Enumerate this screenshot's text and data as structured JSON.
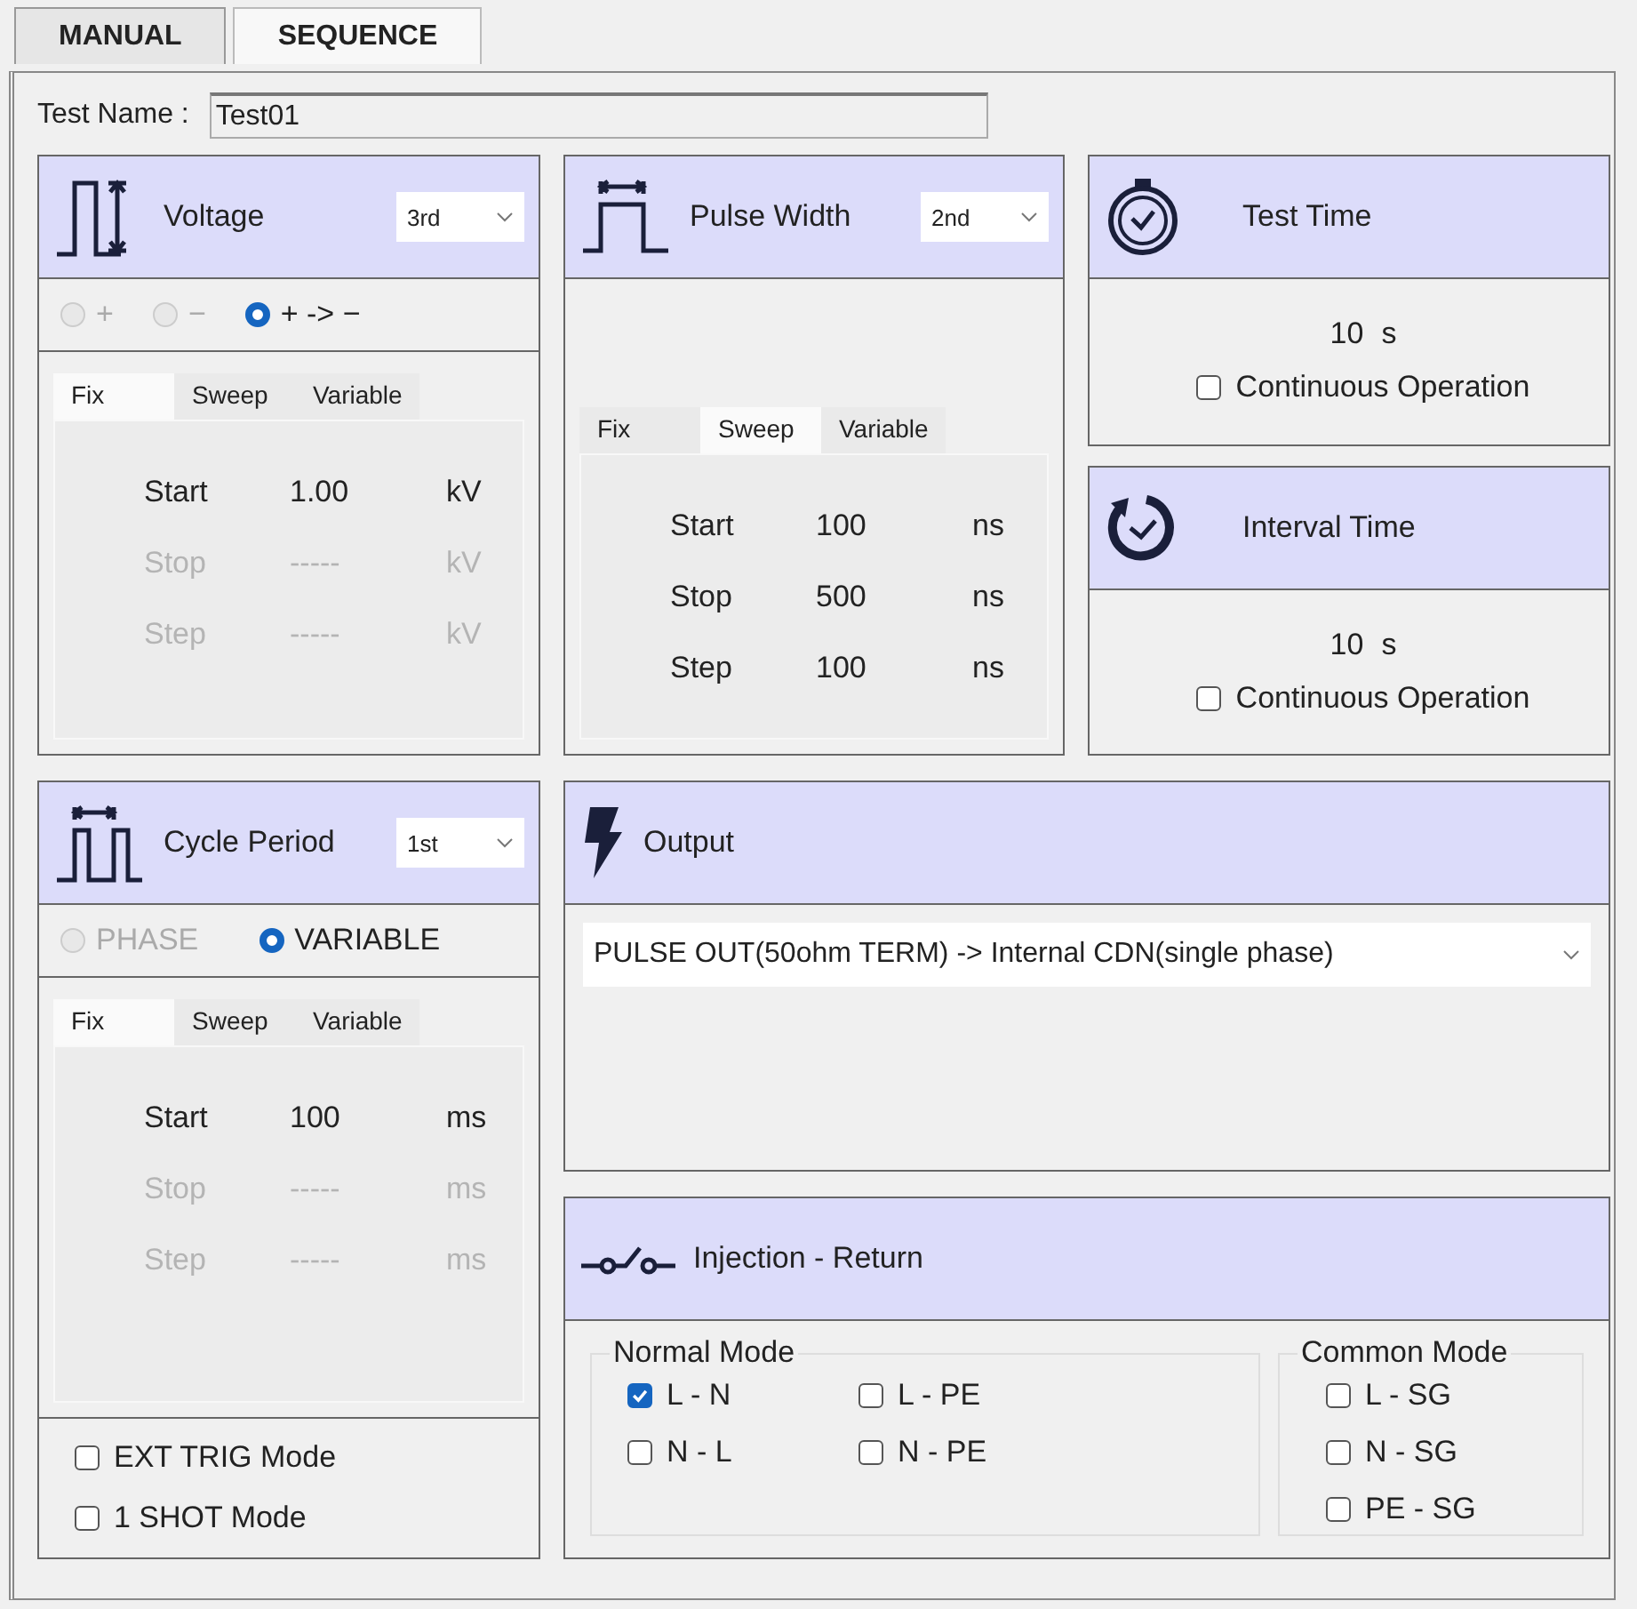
{
  "tabs": [
    {
      "label": "MANUAL",
      "selected": false
    },
    {
      "label": "SEQUENCE",
      "selected": true
    }
  ],
  "test_name": {
    "label": "Test Name :",
    "value": "Test01"
  },
  "voltage": {
    "title": "Voltage",
    "order": "3rd",
    "polarity": [
      {
        "label": "+",
        "selected": false,
        "disabled": true
      },
      {
        "label": "−",
        "selected": false,
        "disabled": true
      },
      {
        "label": "+ -> −",
        "selected": true,
        "disabled": false
      }
    ],
    "subtabs": [
      {
        "label": "Fix",
        "selected": true
      },
      {
        "label": "Sweep",
        "selected": false
      },
      {
        "label": "Variable",
        "selected": false
      }
    ],
    "rows": [
      {
        "label": "Start",
        "value": "1.00",
        "unit": "kV",
        "disabled": false
      },
      {
        "label": "Stop",
        "value": "-----",
        "unit": "kV",
        "disabled": true
      },
      {
        "label": "Step",
        "value": "-----",
        "unit": "kV",
        "disabled": true
      }
    ]
  },
  "pulse_width": {
    "title": "Pulse Width",
    "order": "2nd",
    "subtabs": [
      {
        "label": "Fix",
        "selected": false
      },
      {
        "label": "Sweep",
        "selected": true
      },
      {
        "label": "Variable",
        "selected": false
      }
    ],
    "rows": [
      {
        "label": "Start",
        "value": "100",
        "unit": "ns",
        "disabled": false
      },
      {
        "label": "Stop",
        "value": "500",
        "unit": "ns",
        "disabled": false
      },
      {
        "label": "Step",
        "value": "100",
        "unit": "ns",
        "disabled": false
      }
    ]
  },
  "test_time": {
    "title": "Test Time",
    "value": "10",
    "unit": "s",
    "continuous": {
      "label": "Continuous Operation",
      "checked": false
    }
  },
  "interval_time": {
    "title": "Interval Time",
    "value": "10",
    "unit": "s",
    "continuous": {
      "label": "Continuous Operation",
      "checked": false
    }
  },
  "cycle_period": {
    "title": "Cycle Period",
    "order": "1st",
    "modes": [
      {
        "label": "PHASE",
        "selected": false,
        "disabled": true
      },
      {
        "label": "VARIABLE",
        "selected": true,
        "disabled": false
      }
    ],
    "subtabs": [
      {
        "label": "Fix",
        "selected": true
      },
      {
        "label": "Sweep",
        "selected": false
      },
      {
        "label": "Variable",
        "selected": false
      }
    ],
    "rows": [
      {
        "label": "Start",
        "value": "100",
        "unit": "ms",
        "disabled": false
      },
      {
        "label": "Stop",
        "value": "-----",
        "unit": "ms",
        "disabled": true
      },
      {
        "label": "Step",
        "value": "-----",
        "unit": "ms",
        "disabled": true
      }
    ],
    "options": [
      {
        "label": "EXT TRIG Mode",
        "checked": false
      },
      {
        "label": "1 SHOT Mode",
        "checked": false
      }
    ]
  },
  "output": {
    "title": "Output",
    "selection": "PULSE OUT(50ohm TERM) -> Internal CDN(single phase)"
  },
  "injection_return": {
    "title": "Injection - Return",
    "normal_mode": {
      "label": "Normal Mode",
      "options": [
        {
          "label": "L - N",
          "checked": true
        },
        {
          "label": "L - PE",
          "checked": false
        },
        {
          "label": "N - L",
          "checked": false
        },
        {
          "label": "N - PE",
          "checked": false
        }
      ]
    },
    "common_mode": {
      "label": "Common Mode",
      "options": [
        {
          "label": "L - SG",
          "checked": false
        },
        {
          "label": "N - SG",
          "checked": false
        },
        {
          "label": "PE - SG",
          "checked": false
        }
      ]
    }
  }
}
